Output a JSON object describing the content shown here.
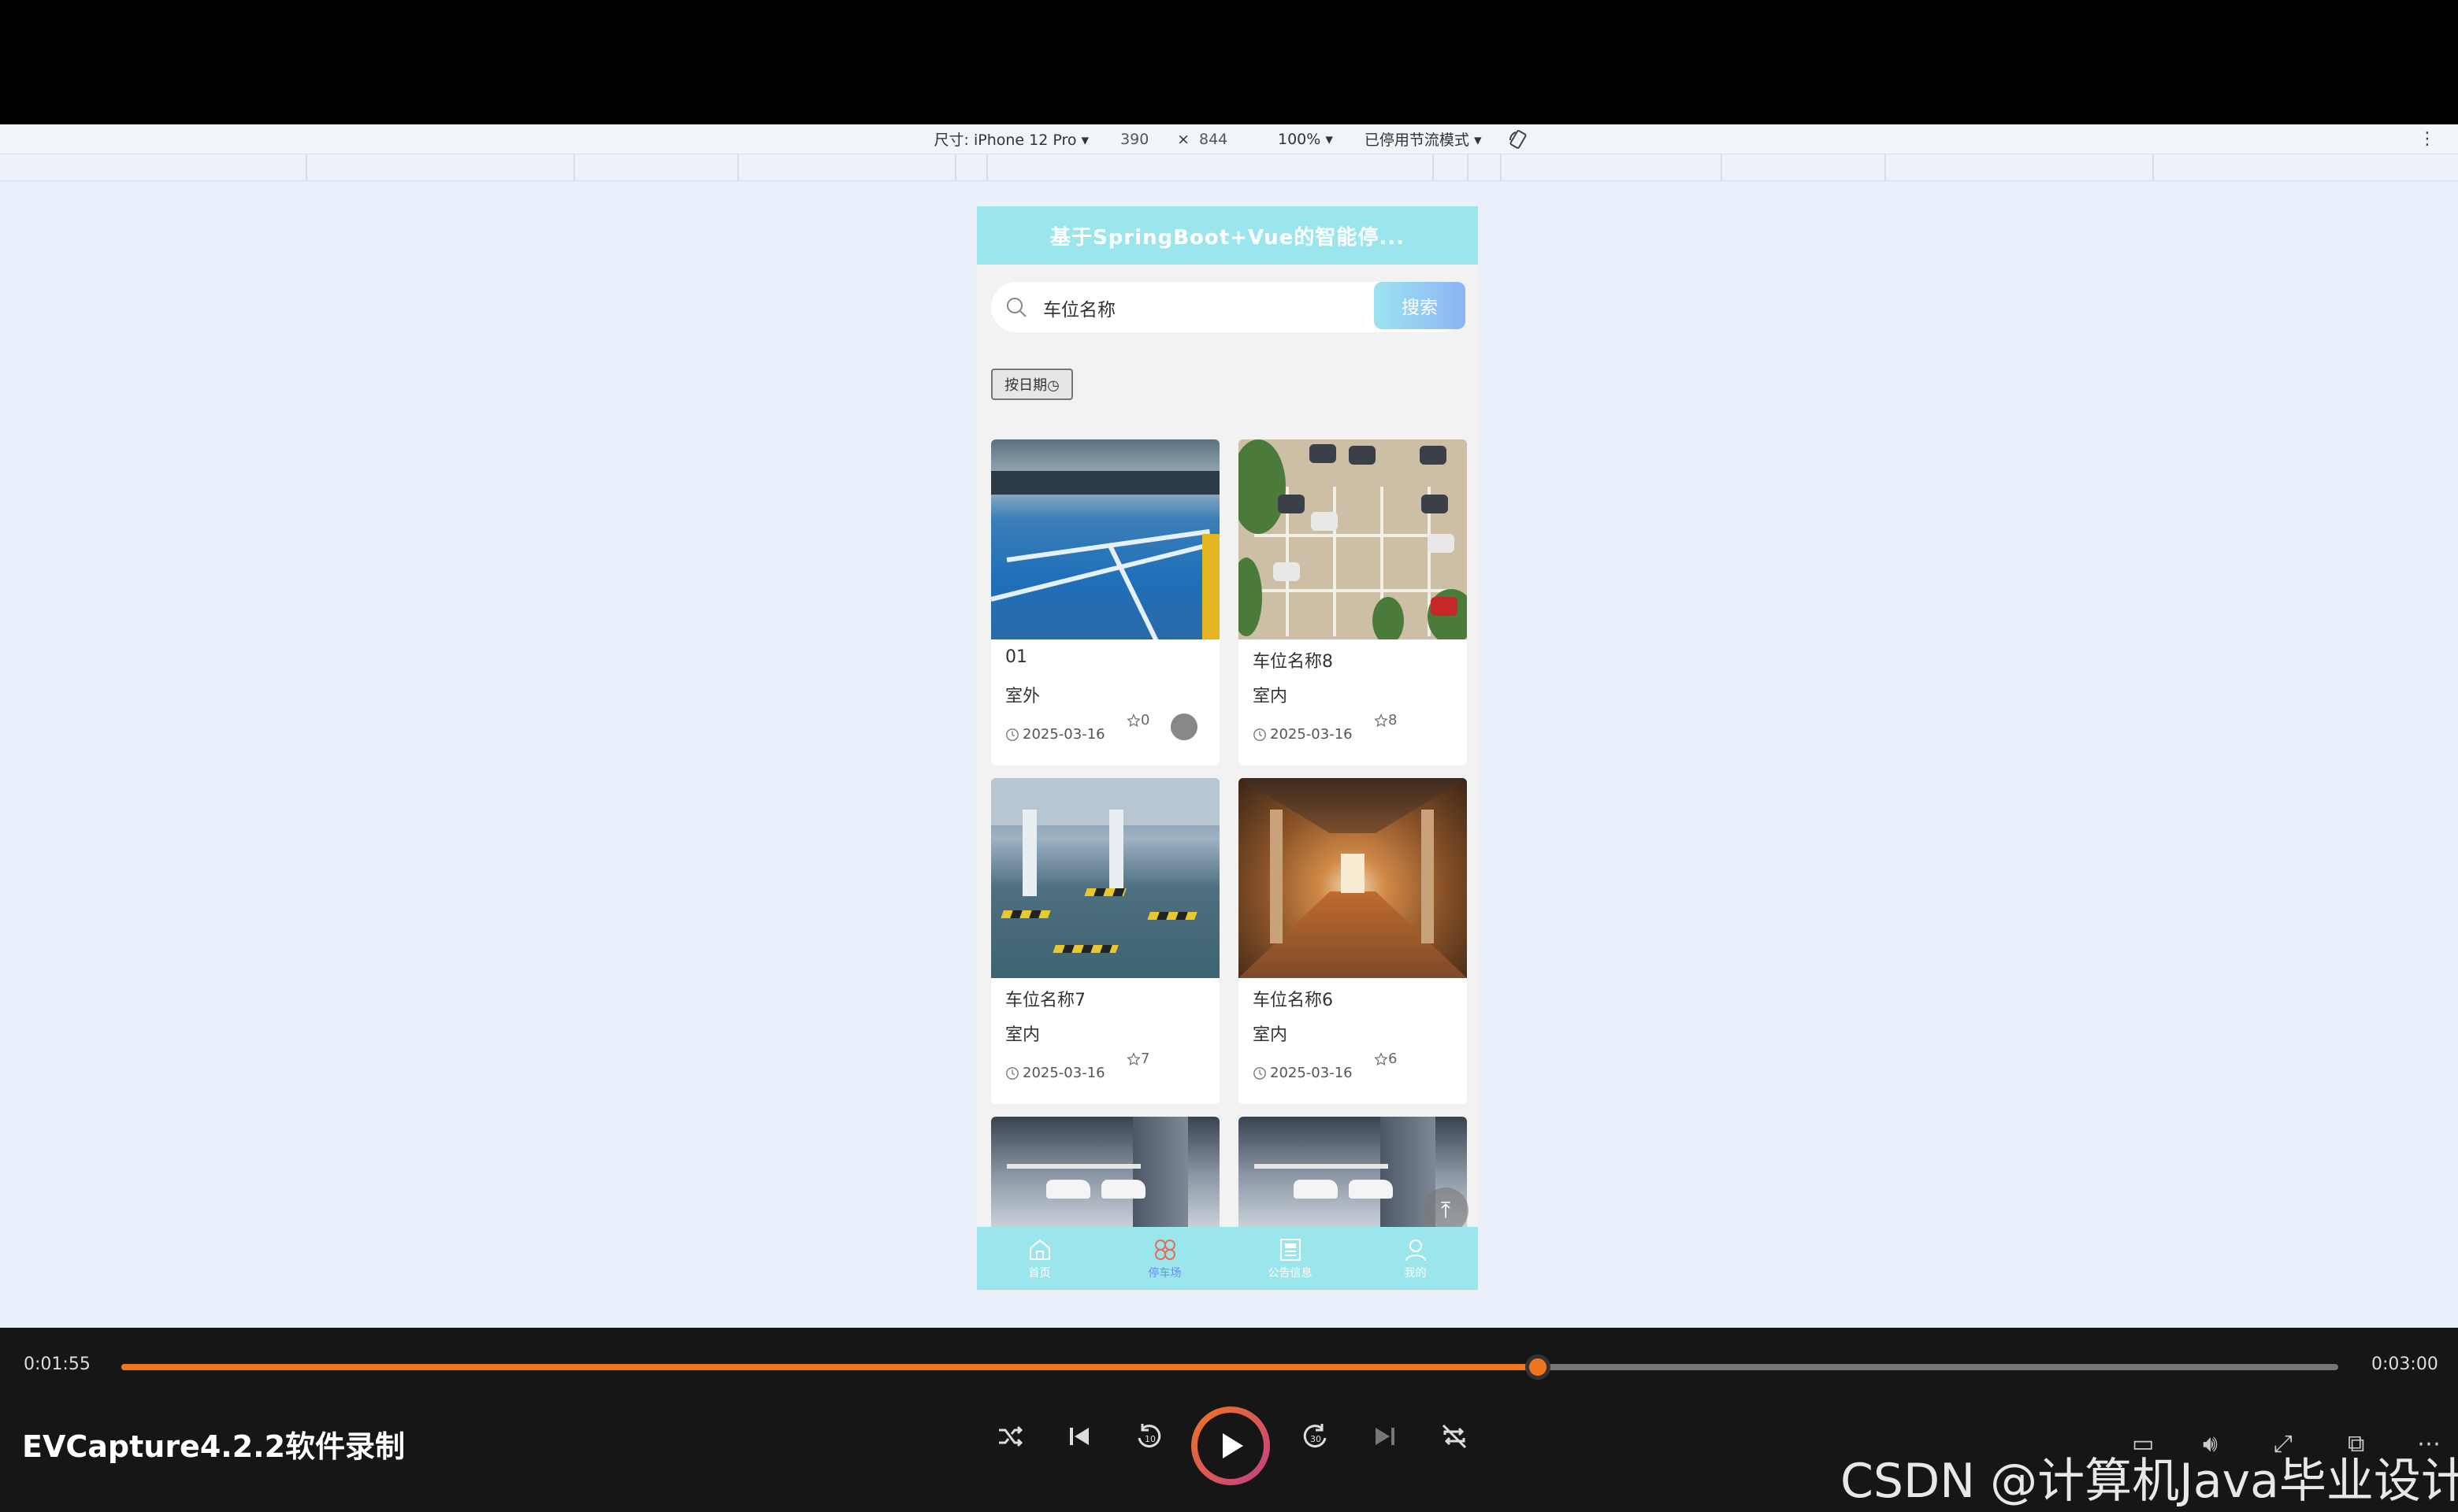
{
  "devtools": {
    "dimensions_label": "尺寸: iPhone 12 Pro ▾",
    "width": "390",
    "times": "×",
    "height": "844",
    "zoom": "100% ▾",
    "throttle": "已停用节流模式 ▾"
  },
  "app": {
    "header_title": "基于SpringBoot+Vue的智能停...",
    "search_placeholder": "车位名称",
    "search_button": "搜索",
    "sort_button": "按日期◷",
    "cards": [
      {
        "name": "01",
        "type": "室外",
        "date": "2025-03-16",
        "favorites": "0"
      },
      {
        "name": "车位名称8",
        "type": "室内",
        "date": "2025-03-16",
        "favorites": "8"
      },
      {
        "name": "车位名称7",
        "type": "室内",
        "date": "2025-03-16",
        "favorites": "7"
      },
      {
        "name": "车位名称6",
        "type": "室内",
        "date": "2025-03-16",
        "favorites": "6"
      }
    ],
    "tabs": [
      {
        "label": "首页",
        "icon": "home-icon"
      },
      {
        "label": "停车场",
        "icon": "grid-icon",
        "active": true
      },
      {
        "label": "公告信息",
        "icon": "news-icon"
      },
      {
        "label": "我的",
        "icon": "user-icon"
      }
    ]
  },
  "player": {
    "current_time": "0:01:55",
    "total_time": "0:03:00",
    "progress": 0.639,
    "title": "EVCapture4.2.2软件录制",
    "watermark": "CSDN @计算机Java毕业设计"
  }
}
